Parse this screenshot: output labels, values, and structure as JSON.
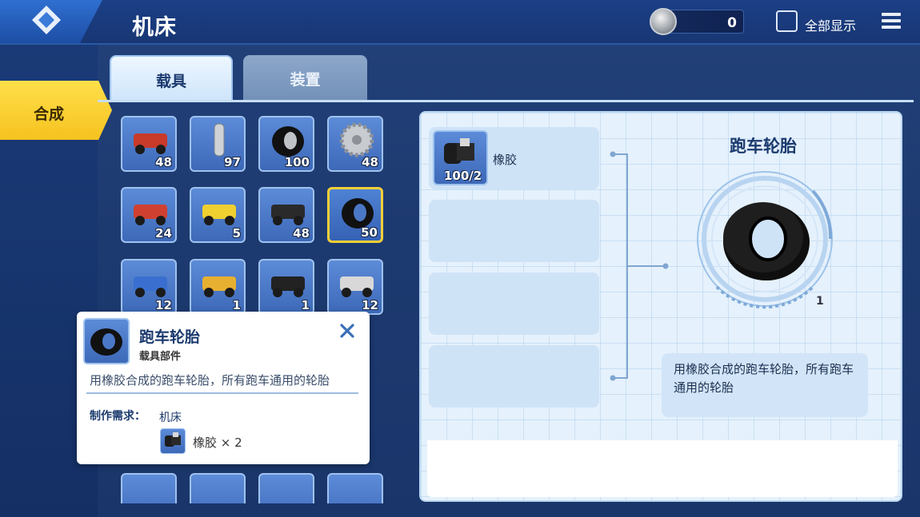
{
  "header": {
    "title": "机床",
    "currency_value": "0",
    "show_all_label": "全部显示"
  },
  "sidebar": {
    "active_label": "合成"
  },
  "tabs": [
    {
      "label": "载具"
    },
    {
      "label": "装置"
    }
  ],
  "grid": [
    {
      "icon": "red-frame-part-icon",
      "count": "48"
    },
    {
      "icon": "axle-part-icon",
      "count": "97"
    },
    {
      "icon": "wheel-part-icon",
      "count": "100"
    },
    {
      "icon": "gear-part-icon",
      "count": "48"
    },
    {
      "icon": "kart-body-red-icon",
      "count": "24"
    },
    {
      "icon": "kart-body-yellow-icon",
      "count": "5"
    },
    {
      "icon": "engine-block-icon",
      "count": "48"
    },
    {
      "icon": "sports-tire-icon",
      "count": "50",
      "selected": true
    },
    {
      "icon": "blue-wing-part-icon",
      "count": "12"
    },
    {
      "icon": "yellow-car-body-icon",
      "count": "1"
    },
    {
      "icon": "chassis-part-icon",
      "count": "1"
    },
    {
      "icon": "silver-wing-part-icon",
      "count": "12"
    }
  ],
  "recipe": {
    "product_name": "跑车轮胎",
    "material_name": "橡胶",
    "material_count": "100/2",
    "yield": "1",
    "description": "用橡胶合成的跑车轮胎，所有跑车通用的轮胎"
  },
  "popup": {
    "name": "跑车轮胎",
    "type": "载具部件",
    "description": "用橡胶合成的跑车轮胎，所有跑车通用的轮胎",
    "requirement_label": "制作需求：",
    "requirement_station": "机床",
    "material": "橡胶 × 2"
  },
  "colors": {
    "accent_yellow": "#f6c21f",
    "panel": "#e5f1fc",
    "background": "#1d3a70"
  }
}
